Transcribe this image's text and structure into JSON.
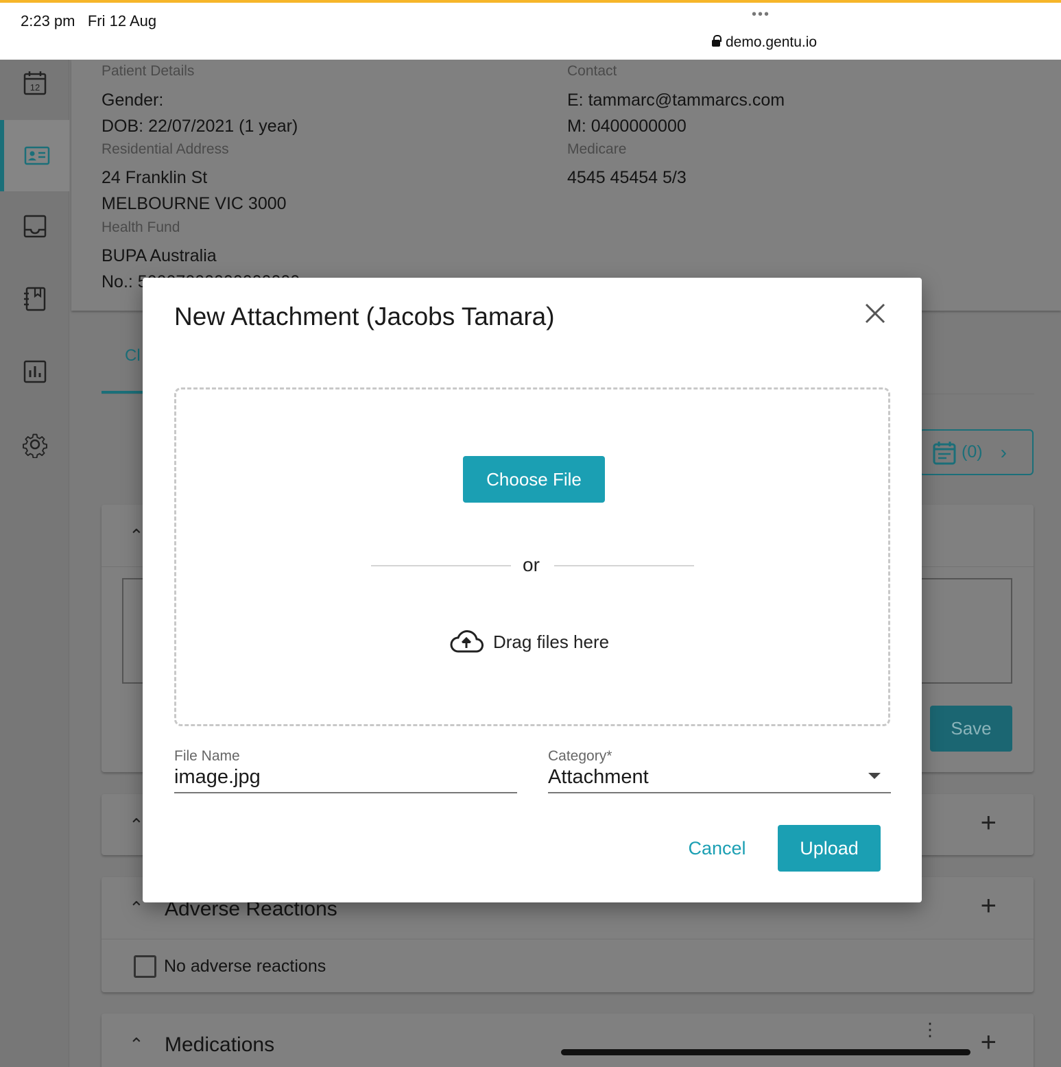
{
  "status_bar": {
    "time": "2:23 pm   Fri 12 Aug",
    "dots": "•••",
    "url": "demo.gentu.io"
  },
  "sidebar": {
    "items": [
      {
        "icon": "calendar-icon",
        "label": "12"
      },
      {
        "icon": "patient-card-icon"
      },
      {
        "icon": "inbox-icon"
      },
      {
        "icon": "notebook-icon"
      },
      {
        "icon": "reports-chart-icon"
      },
      {
        "icon": "settings-gear-icon"
      }
    ],
    "active_index": 1
  },
  "patient": {
    "details_label": "Patient Details",
    "gender": "Gender:",
    "dob": "DOB: 22/07/2021 (1 year)",
    "address_label": "Residential Address",
    "address_line1": "24 Franklin St",
    "address_line2": "MELBOURNE VIC 3000",
    "health_fund_label": "Health Fund",
    "health_fund": "BUPA Australia",
    "health_fund_no": "No.: 50007000000000000",
    "contact_label": "Contact",
    "email": "E: tammarc@tammarcs.com",
    "mobile": "M: 0400000000",
    "medicare_label": "Medicare",
    "medicare": "4545 45454 5/3"
  },
  "page": {
    "tab_label": "Cl",
    "appointments_count": "(0)",
    "save_label": "Save",
    "adverse_reactions_title": "Adverse Reactions",
    "no_adverse_label": "No adverse reactions",
    "medications_title": "Medications"
  },
  "modal": {
    "title": "New Attachment (Jacobs Tamara)",
    "choose_file": "Choose File",
    "or_text": "or",
    "drag_text": "Drag files here",
    "file_name_label": "File Name",
    "file_name_value": "image.jpg",
    "category_label": "Category*",
    "category_value": "Attachment",
    "cancel": "Cancel",
    "upload": "Upload"
  },
  "colors": {
    "accent": "#1b9fb3",
    "accent_dark": "#1b6f79",
    "status_border": "#f6b62a",
    "overlay": "#7b7b7b"
  }
}
